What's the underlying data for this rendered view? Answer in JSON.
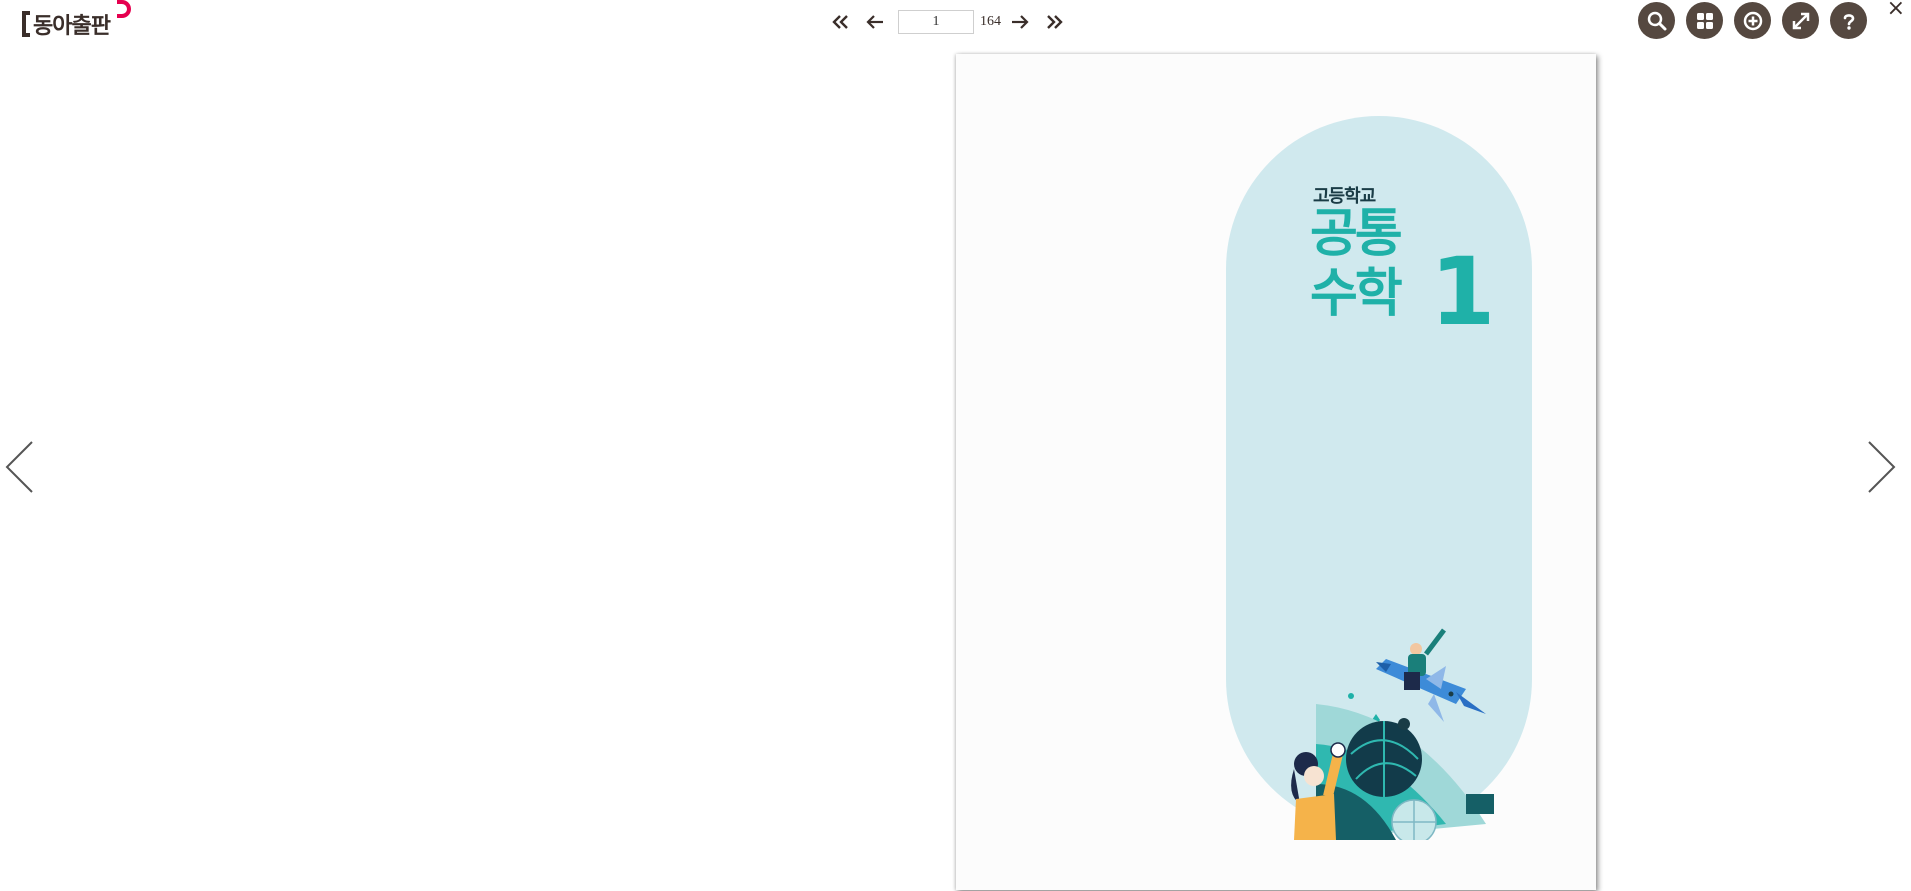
{
  "brand": {
    "logo_text": "동아출판"
  },
  "pager": {
    "first_icon": "double-chevron-left-icon",
    "prev_icon": "arrow-left-icon",
    "current_page": "1",
    "total_pages": "164",
    "next_icon": "arrow-right-icon",
    "last_icon": "double-chevron-right-icon"
  },
  "tools": [
    {
      "name": "search-icon"
    },
    {
      "name": "grid-icon"
    },
    {
      "name": "zoom-in-icon"
    },
    {
      "name": "fullscreen-icon"
    },
    {
      "name": "help-icon"
    }
  ],
  "close": {
    "label": "×"
  },
  "cover": {
    "subtitle": "고등학교",
    "title_line1": "공통",
    "title_line2": "수학",
    "number": "1"
  },
  "colors": {
    "accent": "#1fb1a8",
    "pill_bg": "#d0e9ee",
    "tool_bg": "#554840",
    "brand_red": "#e5004f",
    "text_dark": "#3a2e2a"
  }
}
